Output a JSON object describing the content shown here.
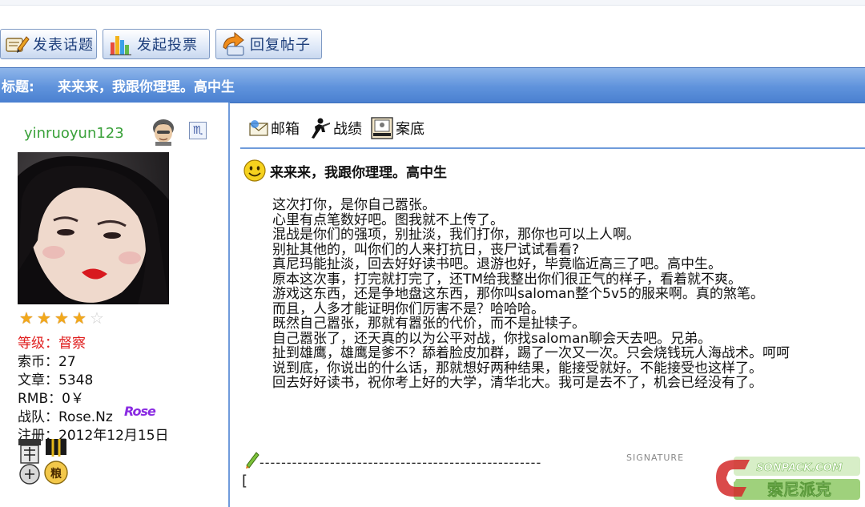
{
  "toolbar": {
    "buttons": [
      {
        "label": "发表话题",
        "icon": "new-topic-icon"
      },
      {
        "label": "发起投票",
        "icon": "poll-icon"
      },
      {
        "label": "回复帖子",
        "icon": "reply-icon"
      }
    ]
  },
  "topic": {
    "label": "标题:",
    "title": "来来来，我跟你理理。高中生"
  },
  "user": {
    "name": "yinruoyun123",
    "stars_filled": 4,
    "stars_total": 5,
    "rank": "等级：督察",
    "coins": "索币：27",
    "posts": "文章：5348",
    "rmb": "RMB：0￥",
    "team": "战队：Rose.Nz",
    "team_logo": "Rose",
    "registered": "注册：2012年12月15日",
    "zodiac_glyph": "♏"
  },
  "userbar": {
    "mailbox": "邮箱",
    "record": "战绩",
    "archive": "案底"
  },
  "post": {
    "title": "来来来，我跟你理理。高中生",
    "lines": [
      "这次打你，是你自己嚣张。",
      "心里有点笔数好吧。图我就不上传了。",
      "混战是你们的强项，别扯淡，我们打你，那你也可以上人啊。",
      "别扯其他的，叫你们的人来打抗日，丧尸试试看看?",
      "真尼玛能扯淡，回去好好读书吧。退游也好，毕竟临近高三了吧。高中生。",
      "原本这次事，打完就打完了，还TM给我整出你们很正气的样子，看着就不爽。",
      "游戏这东西，还是争地盘这东西，那你叫saloman整个5v5的服来啊。真的煞笔。",
      "而且，人多才能证明你们厉害不是？哈哈哈。",
      "既然自己嚣张，那就有嚣张的代价，而不是扯犊子。",
      "自己嚣张了，还天真的以为公平对战，你找saloman聊会天去吧。兄弟。",
      "扯到雄鹰，雄鹰是爹不？舔着脸皮加群，踢了一次又一次。只会烧钱玩人海战术。呵呵",
      "说到底，你说出的什么话，那就想好两种结果，能接受就好。不能接受也这样了。",
      "回去好好读书，祝你考上好的大学，清华北大。我可是去不了，机会已经没有了。"
    ]
  },
  "signature": {
    "dashes": "----------------------------------------------------",
    "label": "SIGNATURE",
    "bracket": "["
  },
  "watermark": {
    "url": "SONPACK.COM",
    "text": "索尼派克"
  }
}
